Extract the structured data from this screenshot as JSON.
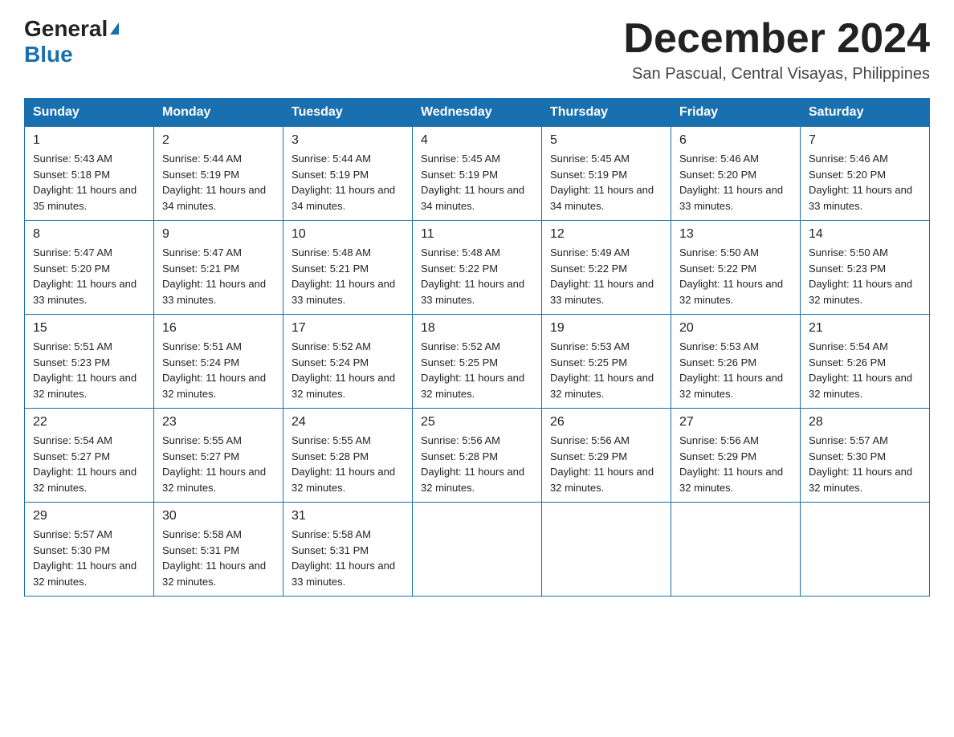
{
  "header": {
    "logo_general": "General",
    "logo_blue": "Blue",
    "month_title": "December 2024",
    "location": "San Pascual, Central Visayas, Philippines"
  },
  "weekdays": [
    "Sunday",
    "Monday",
    "Tuesday",
    "Wednesday",
    "Thursday",
    "Friday",
    "Saturday"
  ],
  "weeks": [
    [
      {
        "day": "1",
        "sunrise": "Sunrise: 5:43 AM",
        "sunset": "Sunset: 5:18 PM",
        "daylight": "Daylight: 11 hours and 35 minutes."
      },
      {
        "day": "2",
        "sunrise": "Sunrise: 5:44 AM",
        "sunset": "Sunset: 5:19 PM",
        "daylight": "Daylight: 11 hours and 34 minutes."
      },
      {
        "day": "3",
        "sunrise": "Sunrise: 5:44 AM",
        "sunset": "Sunset: 5:19 PM",
        "daylight": "Daylight: 11 hours and 34 minutes."
      },
      {
        "day": "4",
        "sunrise": "Sunrise: 5:45 AM",
        "sunset": "Sunset: 5:19 PM",
        "daylight": "Daylight: 11 hours and 34 minutes."
      },
      {
        "day": "5",
        "sunrise": "Sunrise: 5:45 AM",
        "sunset": "Sunset: 5:19 PM",
        "daylight": "Daylight: 11 hours and 34 minutes."
      },
      {
        "day": "6",
        "sunrise": "Sunrise: 5:46 AM",
        "sunset": "Sunset: 5:20 PM",
        "daylight": "Daylight: 11 hours and 33 minutes."
      },
      {
        "day": "7",
        "sunrise": "Sunrise: 5:46 AM",
        "sunset": "Sunset: 5:20 PM",
        "daylight": "Daylight: 11 hours and 33 minutes."
      }
    ],
    [
      {
        "day": "8",
        "sunrise": "Sunrise: 5:47 AM",
        "sunset": "Sunset: 5:20 PM",
        "daylight": "Daylight: 11 hours and 33 minutes."
      },
      {
        "day": "9",
        "sunrise": "Sunrise: 5:47 AM",
        "sunset": "Sunset: 5:21 PM",
        "daylight": "Daylight: 11 hours and 33 minutes."
      },
      {
        "day": "10",
        "sunrise": "Sunrise: 5:48 AM",
        "sunset": "Sunset: 5:21 PM",
        "daylight": "Daylight: 11 hours and 33 minutes."
      },
      {
        "day": "11",
        "sunrise": "Sunrise: 5:48 AM",
        "sunset": "Sunset: 5:22 PM",
        "daylight": "Daylight: 11 hours and 33 minutes."
      },
      {
        "day": "12",
        "sunrise": "Sunrise: 5:49 AM",
        "sunset": "Sunset: 5:22 PM",
        "daylight": "Daylight: 11 hours and 33 minutes."
      },
      {
        "day": "13",
        "sunrise": "Sunrise: 5:50 AM",
        "sunset": "Sunset: 5:22 PM",
        "daylight": "Daylight: 11 hours and 32 minutes."
      },
      {
        "day": "14",
        "sunrise": "Sunrise: 5:50 AM",
        "sunset": "Sunset: 5:23 PM",
        "daylight": "Daylight: 11 hours and 32 minutes."
      }
    ],
    [
      {
        "day": "15",
        "sunrise": "Sunrise: 5:51 AM",
        "sunset": "Sunset: 5:23 PM",
        "daylight": "Daylight: 11 hours and 32 minutes."
      },
      {
        "day": "16",
        "sunrise": "Sunrise: 5:51 AM",
        "sunset": "Sunset: 5:24 PM",
        "daylight": "Daylight: 11 hours and 32 minutes."
      },
      {
        "day": "17",
        "sunrise": "Sunrise: 5:52 AM",
        "sunset": "Sunset: 5:24 PM",
        "daylight": "Daylight: 11 hours and 32 minutes."
      },
      {
        "day": "18",
        "sunrise": "Sunrise: 5:52 AM",
        "sunset": "Sunset: 5:25 PM",
        "daylight": "Daylight: 11 hours and 32 minutes."
      },
      {
        "day": "19",
        "sunrise": "Sunrise: 5:53 AM",
        "sunset": "Sunset: 5:25 PM",
        "daylight": "Daylight: 11 hours and 32 minutes."
      },
      {
        "day": "20",
        "sunrise": "Sunrise: 5:53 AM",
        "sunset": "Sunset: 5:26 PM",
        "daylight": "Daylight: 11 hours and 32 minutes."
      },
      {
        "day": "21",
        "sunrise": "Sunrise: 5:54 AM",
        "sunset": "Sunset: 5:26 PM",
        "daylight": "Daylight: 11 hours and 32 minutes."
      }
    ],
    [
      {
        "day": "22",
        "sunrise": "Sunrise: 5:54 AM",
        "sunset": "Sunset: 5:27 PM",
        "daylight": "Daylight: 11 hours and 32 minutes."
      },
      {
        "day": "23",
        "sunrise": "Sunrise: 5:55 AM",
        "sunset": "Sunset: 5:27 PM",
        "daylight": "Daylight: 11 hours and 32 minutes."
      },
      {
        "day": "24",
        "sunrise": "Sunrise: 5:55 AM",
        "sunset": "Sunset: 5:28 PM",
        "daylight": "Daylight: 11 hours and 32 minutes."
      },
      {
        "day": "25",
        "sunrise": "Sunrise: 5:56 AM",
        "sunset": "Sunset: 5:28 PM",
        "daylight": "Daylight: 11 hours and 32 minutes."
      },
      {
        "day": "26",
        "sunrise": "Sunrise: 5:56 AM",
        "sunset": "Sunset: 5:29 PM",
        "daylight": "Daylight: 11 hours and 32 minutes."
      },
      {
        "day": "27",
        "sunrise": "Sunrise: 5:56 AM",
        "sunset": "Sunset: 5:29 PM",
        "daylight": "Daylight: 11 hours and 32 minutes."
      },
      {
        "day": "28",
        "sunrise": "Sunrise: 5:57 AM",
        "sunset": "Sunset: 5:30 PM",
        "daylight": "Daylight: 11 hours and 32 minutes."
      }
    ],
    [
      {
        "day": "29",
        "sunrise": "Sunrise: 5:57 AM",
        "sunset": "Sunset: 5:30 PM",
        "daylight": "Daylight: 11 hours and 32 minutes."
      },
      {
        "day": "30",
        "sunrise": "Sunrise: 5:58 AM",
        "sunset": "Sunset: 5:31 PM",
        "daylight": "Daylight: 11 hours and 32 minutes."
      },
      {
        "day": "31",
        "sunrise": "Sunrise: 5:58 AM",
        "sunset": "Sunset: 5:31 PM",
        "daylight": "Daylight: 11 hours and 33 minutes."
      },
      null,
      null,
      null,
      null
    ]
  ]
}
